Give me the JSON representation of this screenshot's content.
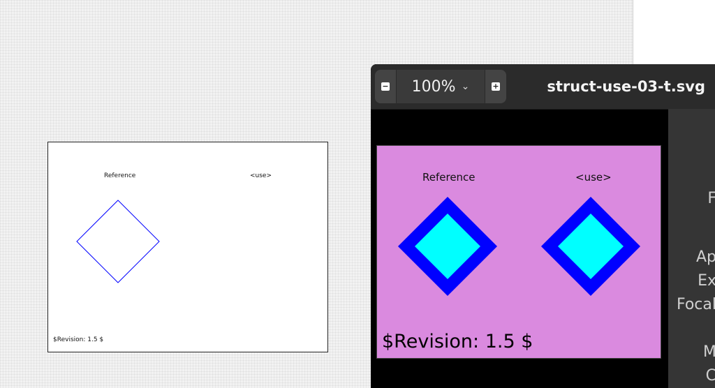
{
  "outline": {
    "reference_label": "Reference",
    "use_label": "<use>",
    "revision": "$Revision: 1.5 $"
  },
  "viewer": {
    "zoom": "100%",
    "filename": "struct-use-03-t.svg",
    "preview": {
      "reference_label": "Reference",
      "use_label": "<use>",
      "revision": "$Revision: 1.5 $"
    },
    "sidebar_labels": [
      "F",
      "Ap",
      "Ex",
      "Focal",
      "M",
      "C"
    ]
  },
  "colors": {
    "preview_bg": "#da8adf",
    "diamond_stroke": "#0000ff",
    "diamond_fill": "#00ffff"
  }
}
